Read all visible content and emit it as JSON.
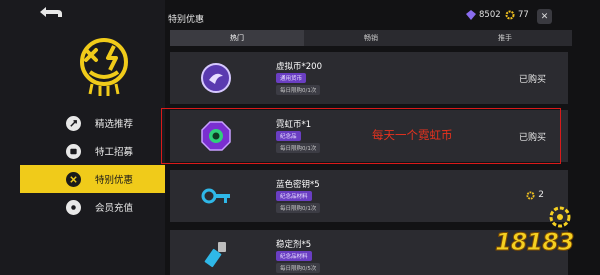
{
  "header": {
    "title": "特别优惠"
  },
  "currencies": [
    {
      "icon": "purple-gem-icon",
      "value": "8502",
      "color": "#8a6cf0"
    },
    {
      "icon": "gold-gear-icon",
      "value": "77",
      "color": "#f0c020"
    }
  ],
  "close_label": "✕",
  "sidebar": {
    "items": [
      {
        "label": "精选推荐",
        "icon": "recommend-icon",
        "active": false
      },
      {
        "label": "特工招募",
        "icon": "recruit-icon",
        "active": false
      },
      {
        "label": "特别优惠",
        "icon": "special-offer-icon",
        "active": true
      },
      {
        "label": "会员充值",
        "icon": "member-recharge-icon",
        "active": false
      }
    ]
  },
  "tabs": [
    {
      "label": "热门",
      "active": true
    },
    {
      "label": "畅销",
      "active": false
    },
    {
      "label": "推手",
      "active": false
    }
  ],
  "items": [
    {
      "name": "虚拟币*200",
      "tag": "通用货币",
      "limit": "每日限购0/1次",
      "status": "已购买",
      "icon": "virtual-coin-icon"
    },
    {
      "name": "霓虹币*1",
      "tag": "纪念品",
      "limit": "每日限购0/1次",
      "status": "已购买",
      "icon": "neon-coin-icon"
    },
    {
      "name": "蓝色密钥*5",
      "tag": "纪念品材料",
      "limit": "每日限购0/1次",
      "price": "2",
      "icon": "blue-key-icon"
    },
    {
      "name": "稳定剂*5",
      "tag": "纪念品材料",
      "limit": "每日限购0/5次",
      "icon": "stabilizer-icon"
    }
  ],
  "annotation": "每天一个霓虹币",
  "watermark": "18183",
  "colors": {
    "accent": "#f0cb1a",
    "highlight": "#d91a1a"
  }
}
